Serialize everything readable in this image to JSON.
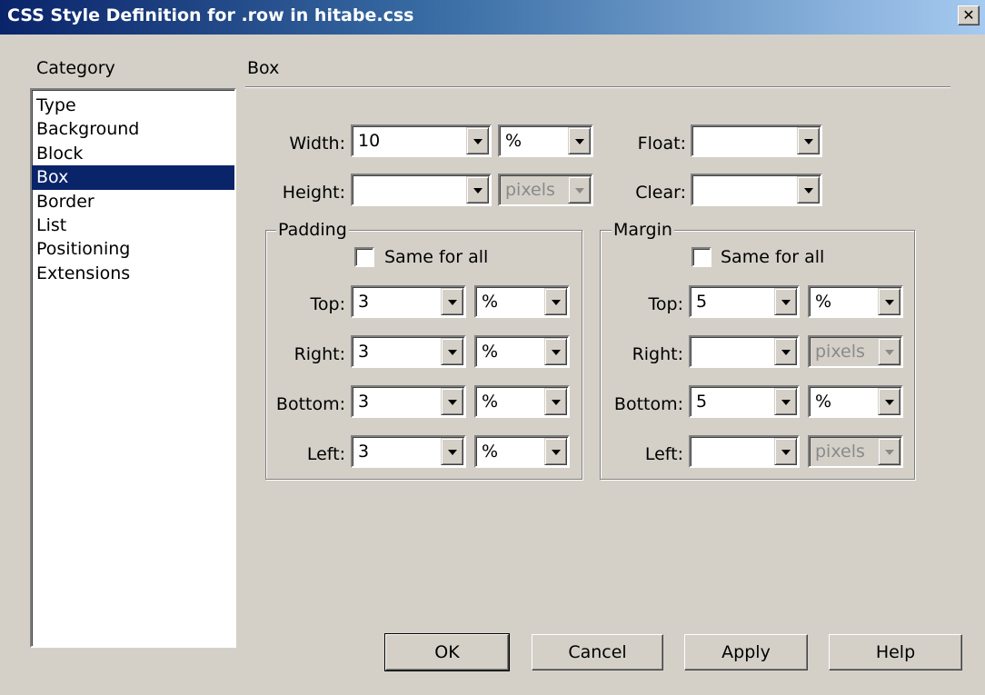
{
  "window": {
    "title": "CSS Style Definition for .row in hitabe.css",
    "close_symbol": "✕"
  },
  "category": {
    "heading": "Category",
    "items": [
      "Type",
      "Background",
      "Block",
      "Box",
      "Border",
      "List",
      "Positioning",
      "Extensions"
    ],
    "selected": "Box"
  },
  "panel": {
    "heading": "Box",
    "width": {
      "label": "Width:",
      "value": "10",
      "unit": "%"
    },
    "height": {
      "label": "Height:",
      "value": "",
      "unit": "pixels",
      "unit_disabled": true
    },
    "float": {
      "label": "Float:",
      "value": ""
    },
    "clear": {
      "label": "Clear:",
      "value": ""
    }
  },
  "padding": {
    "legend": "Padding",
    "same_for_all": {
      "label": "Same for all",
      "checked": false
    },
    "top": {
      "label": "Top:",
      "value": "3",
      "unit": "%"
    },
    "right": {
      "label": "Right:",
      "value": "3",
      "unit": "%"
    },
    "bottom": {
      "label": "Bottom:",
      "value": "3",
      "unit": "%"
    },
    "left": {
      "label": "Left:",
      "value": "3",
      "unit": "%"
    }
  },
  "margin": {
    "legend": "Margin",
    "same_for_all": {
      "label": "Same for all",
      "checked": false
    },
    "top": {
      "label": "Top:",
      "value": "5",
      "unit": "%"
    },
    "right": {
      "label": "Right:",
      "value": "",
      "unit": "pixels",
      "unit_disabled": true
    },
    "bottom": {
      "label": "Bottom:",
      "value": "5",
      "unit": "%"
    },
    "left": {
      "label": "Left:",
      "value": "",
      "unit": "pixels",
      "unit_disabled": true
    }
  },
  "buttons": {
    "ok": "OK",
    "cancel": "Cancel",
    "apply": "Apply",
    "help": "Help"
  },
  "colors": {
    "title_gradient_start": "#0a246a",
    "selection": "#0a246a",
    "face": "#d4d0c8"
  },
  "icons": {
    "close": "close-icon",
    "dropdown": "chevron-down-icon"
  }
}
